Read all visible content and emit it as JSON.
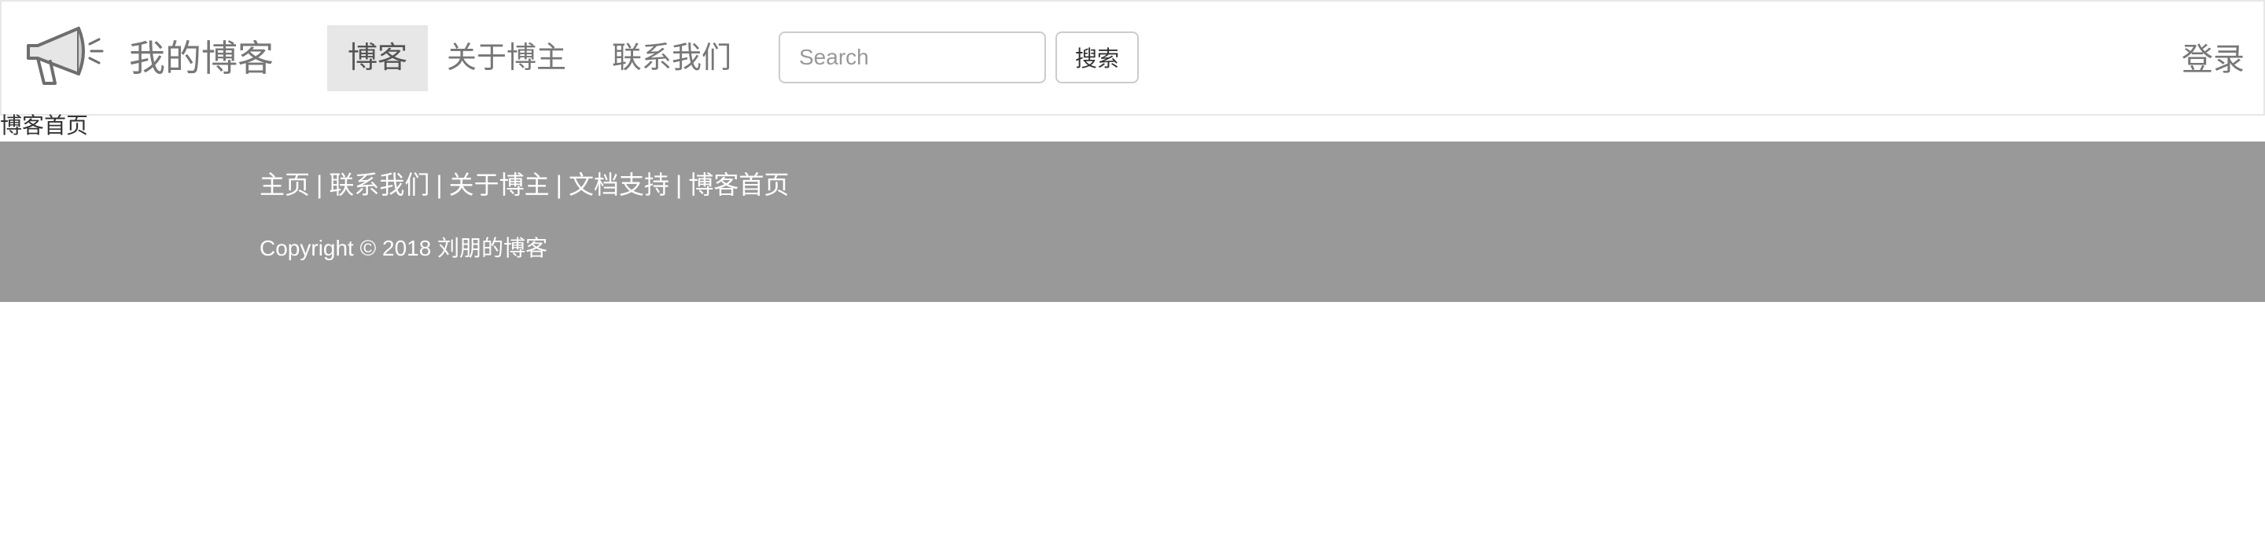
{
  "navbar": {
    "logo_icon": "megaphone-icon",
    "brand": "我的博客",
    "nav_items": [
      {
        "label": "博客",
        "active": true
      },
      {
        "label": "关于博主",
        "active": false
      },
      {
        "label": "联系我们",
        "active": false
      }
    ],
    "search": {
      "placeholder": "Search",
      "value": "",
      "button_label": "搜索"
    },
    "login_label": "登录"
  },
  "breadcrumb": "博客首页",
  "footer": {
    "links": [
      "主页",
      "联系我们",
      "关于博主",
      "文档支持",
      "博客首页"
    ],
    "separator": "|",
    "copyright": "Copyright © 2018 刘朋的博客"
  },
  "colors": {
    "navbar_border": "#e7e7e7",
    "active_nav_bg": "#e7e7e7",
    "nav_text": "#777777",
    "footer_bg": "#999999",
    "footer_text": "#ffffff"
  }
}
